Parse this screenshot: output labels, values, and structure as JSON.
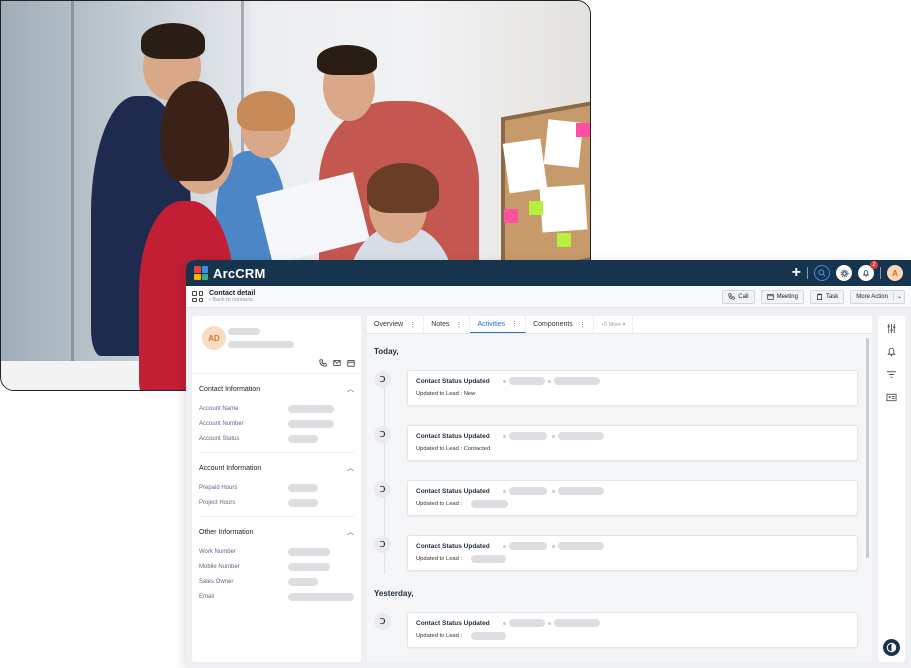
{
  "app": {
    "brand": "ArcCRM",
    "avatar_initial": "A",
    "notification_count": "2",
    "logo_colors": [
      "#e8463c",
      "#3b8ee8",
      "#f4b400",
      "#36b37e"
    ]
  },
  "header": {
    "title": "Contact detail",
    "back_link": "‹ Back to contacts",
    "actions": {
      "call": "Call",
      "meeting": "Meeting",
      "task": "Task",
      "more": "More Action"
    }
  },
  "contact": {
    "initials": "AD"
  },
  "sections": {
    "contact_info": {
      "title": "Contact Information",
      "fields": [
        "Account Name",
        "Account Number",
        "Account Status"
      ]
    },
    "account_info": {
      "title": "Account Information",
      "fields": [
        "Prepaid Hours",
        "Project Hours"
      ]
    },
    "other_info": {
      "title": "Other Information",
      "fields": [
        "Work Number",
        "Mobile Number",
        "Sales Owner",
        "Email"
      ]
    }
  },
  "tabs": [
    "Overview",
    "Notes",
    "Activities",
    "Components",
    "+5 More ▾"
  ],
  "activity_groups": {
    "today": "Today,",
    "yesterday": "Yesterday,"
  },
  "activities": [
    {
      "title": "Contact Status Updated",
      "detail": "Updated to Lead : New"
    },
    {
      "title": "Contact Status Updated",
      "detail": "Updated to Lead : Contacted"
    },
    {
      "title": "Contact Status Updated",
      "detail": "Updated to Lead :"
    },
    {
      "title": "Contact Status Updated",
      "detail": "Updated to Lead :"
    },
    {
      "title": "Contact Status Updated",
      "detail": "Updated to Lead :"
    }
  ],
  "theme": {
    "accent": "#2c6fd1",
    "topbar": "#17344f"
  }
}
